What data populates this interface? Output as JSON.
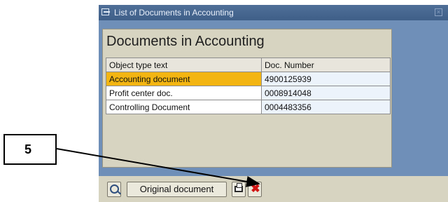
{
  "window": {
    "title": "List of Documents in Accounting",
    "title_icon": "window-icon",
    "close_icon": "close-icon"
  },
  "panel": {
    "title": "Documents in Accounting"
  },
  "table": {
    "columns": [
      "Object type text",
      "Doc. Number"
    ],
    "rows": [
      {
        "object_type": "Accounting document",
        "doc_number": "4900125939"
      },
      {
        "object_type": "Profit center doc.",
        "doc_number": "0008914048"
      },
      {
        "object_type": "Controlling Document",
        "doc_number": "0004483356"
      }
    ],
    "selected_row": 0
  },
  "toolbar": {
    "zoom_icon": "zoom-icon",
    "original_document_label": "Original document",
    "print_icon": "print-icon",
    "cancel_icon": "cancel-icon"
  },
  "callout": {
    "number": "5"
  },
  "colors": {
    "window_bg": "#6f8fb8",
    "panel_bg": "#d8d4c2",
    "selected_cell": "#f2b511",
    "cancel_red": "#d11414"
  }
}
